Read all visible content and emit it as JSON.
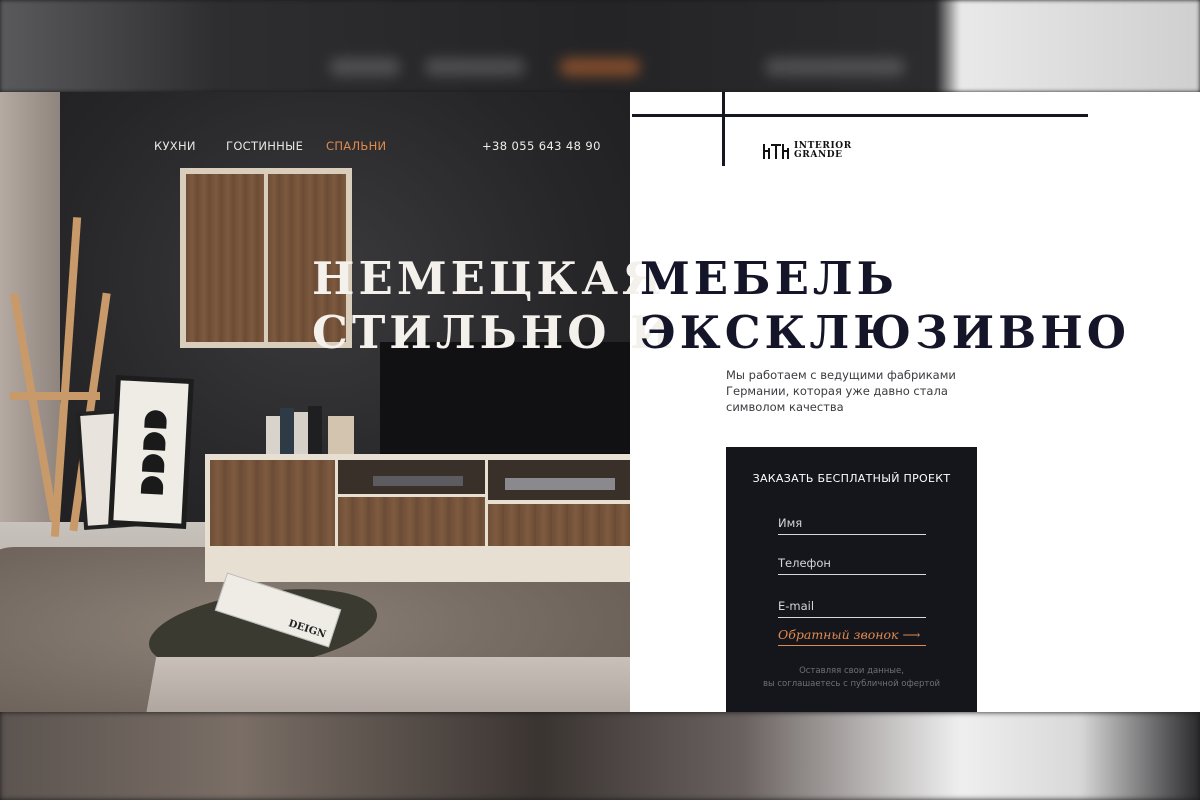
{
  "nav": {
    "items": [
      {
        "label": "КУХНИ",
        "active": false
      },
      {
        "label": "ГОСТИННЫЕ",
        "active": false
      },
      {
        "label": "СПАЛЬНИ",
        "active": true
      }
    ],
    "phone": "+38 055 643 48 90"
  },
  "logo": {
    "mark": "logo-icon",
    "text": "INTERIOR\nGRANDE"
  },
  "hero": {
    "line1_left": "НЕМЕЦКАЯ",
    "line1_right": "МЕБЕЛЬ",
    "line2_left": "СТИЛЬНО И",
    "line2_right": "ЭКСКЛЮЗИВНО"
  },
  "description": "Мы работаем с ведущими фабриками Германии, которая уже давно стала символом качества",
  "form": {
    "title": "ЗАКАЗАТЬ БЕСПЛАТНЫЙ ПРОЕКТ",
    "fields": {
      "name_placeholder": "Имя",
      "phone_placeholder": "Телефон",
      "email_placeholder": "E-mail"
    },
    "callback_label": "Обратный звонок",
    "callback_icon": "arrow-right-icon",
    "consent": "Оставляя свои данные,\nвы соглашаетесь с публичной офертой"
  },
  "photo": {
    "magazine_text": "DEIGN"
  },
  "colors": {
    "accent": "#e08a4e",
    "dark": "#15151c",
    "headline_dark": "#15152a",
    "headline_light": "#f4f1ec"
  }
}
